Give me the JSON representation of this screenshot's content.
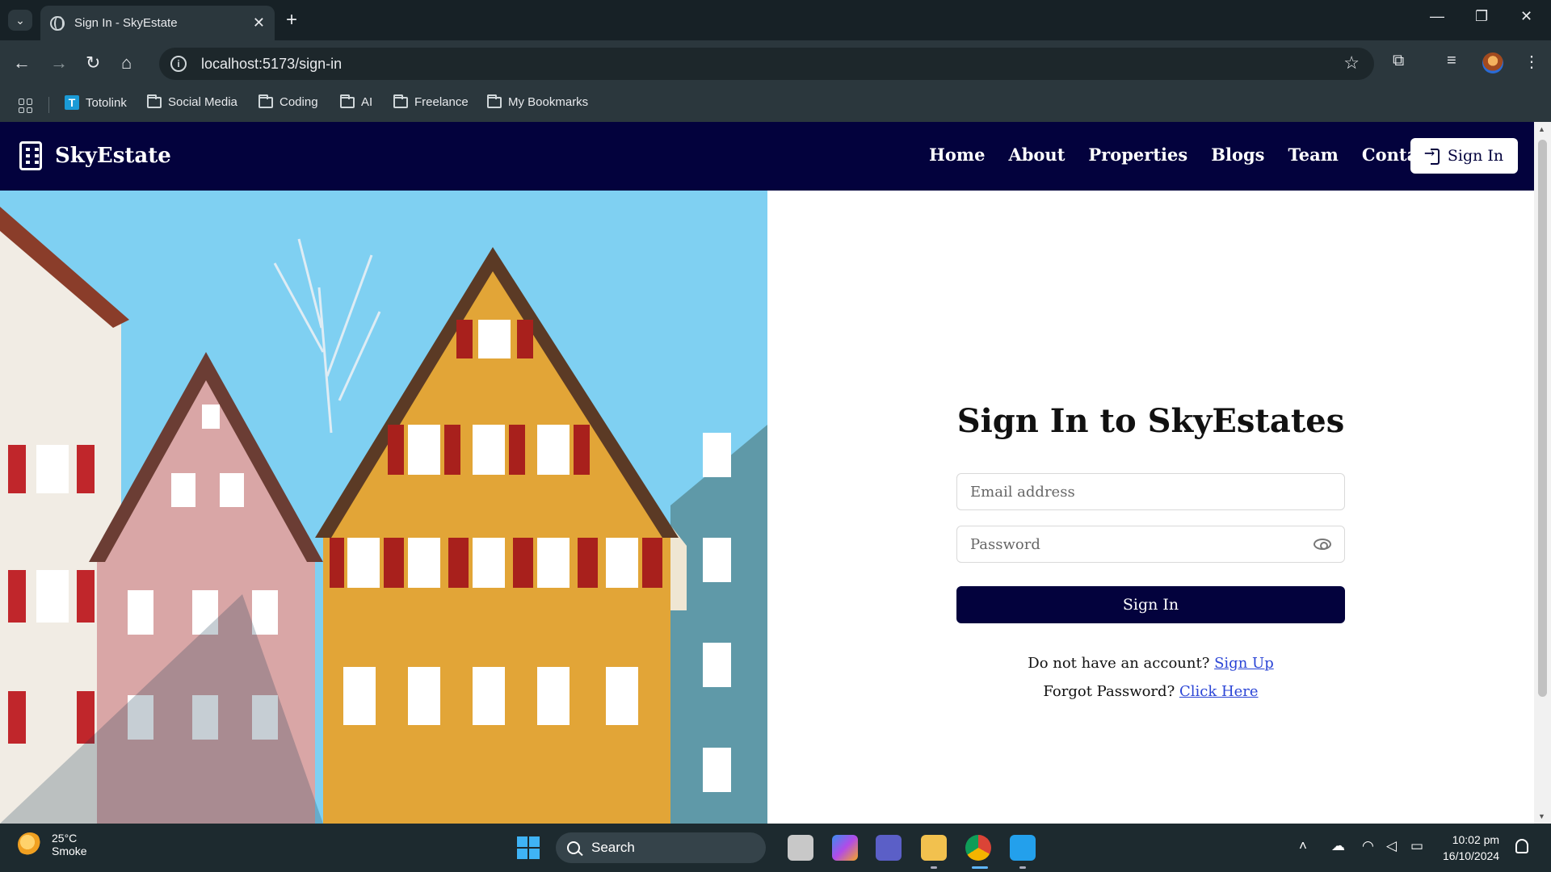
{
  "browser": {
    "tab_title": "Sign In - SkyEstate",
    "url": "localhost:5173/sign-in",
    "bookmarks": [
      {
        "label": "Totolink",
        "icon": "totolink-icon"
      },
      {
        "label": "Social Media",
        "icon": "folder-icon"
      },
      {
        "label": "Coding",
        "icon": "folder-icon"
      },
      {
        "label": "AI",
        "icon": "folder-icon"
      },
      {
        "label": "Freelance",
        "icon": "folder-icon"
      },
      {
        "label": "My Bookmarks",
        "icon": "folder-icon"
      }
    ]
  },
  "site": {
    "brand": "SkyEstate",
    "nav": [
      "Home",
      "About",
      "Properties",
      "Blogs",
      "Team",
      "Contact"
    ],
    "signin_label": "Sign In"
  },
  "form": {
    "title": "Sign In to SkyEstates",
    "email_placeholder": "Email address",
    "password_placeholder": "Password",
    "submit_label": "Sign In",
    "no_account_text": "Do not have an account?",
    "signup_link": "Sign Up",
    "forgot_text": "Forgot Password?",
    "forgot_link": "Click Here"
  },
  "taskbar": {
    "weather_temp": "25°C",
    "weather_desc": "Smoke",
    "search_label": "Search",
    "time": "10:02 pm",
    "date": "16/10/2024"
  },
  "colors": {
    "navy": "#03023d",
    "link": "#2b45d6"
  }
}
